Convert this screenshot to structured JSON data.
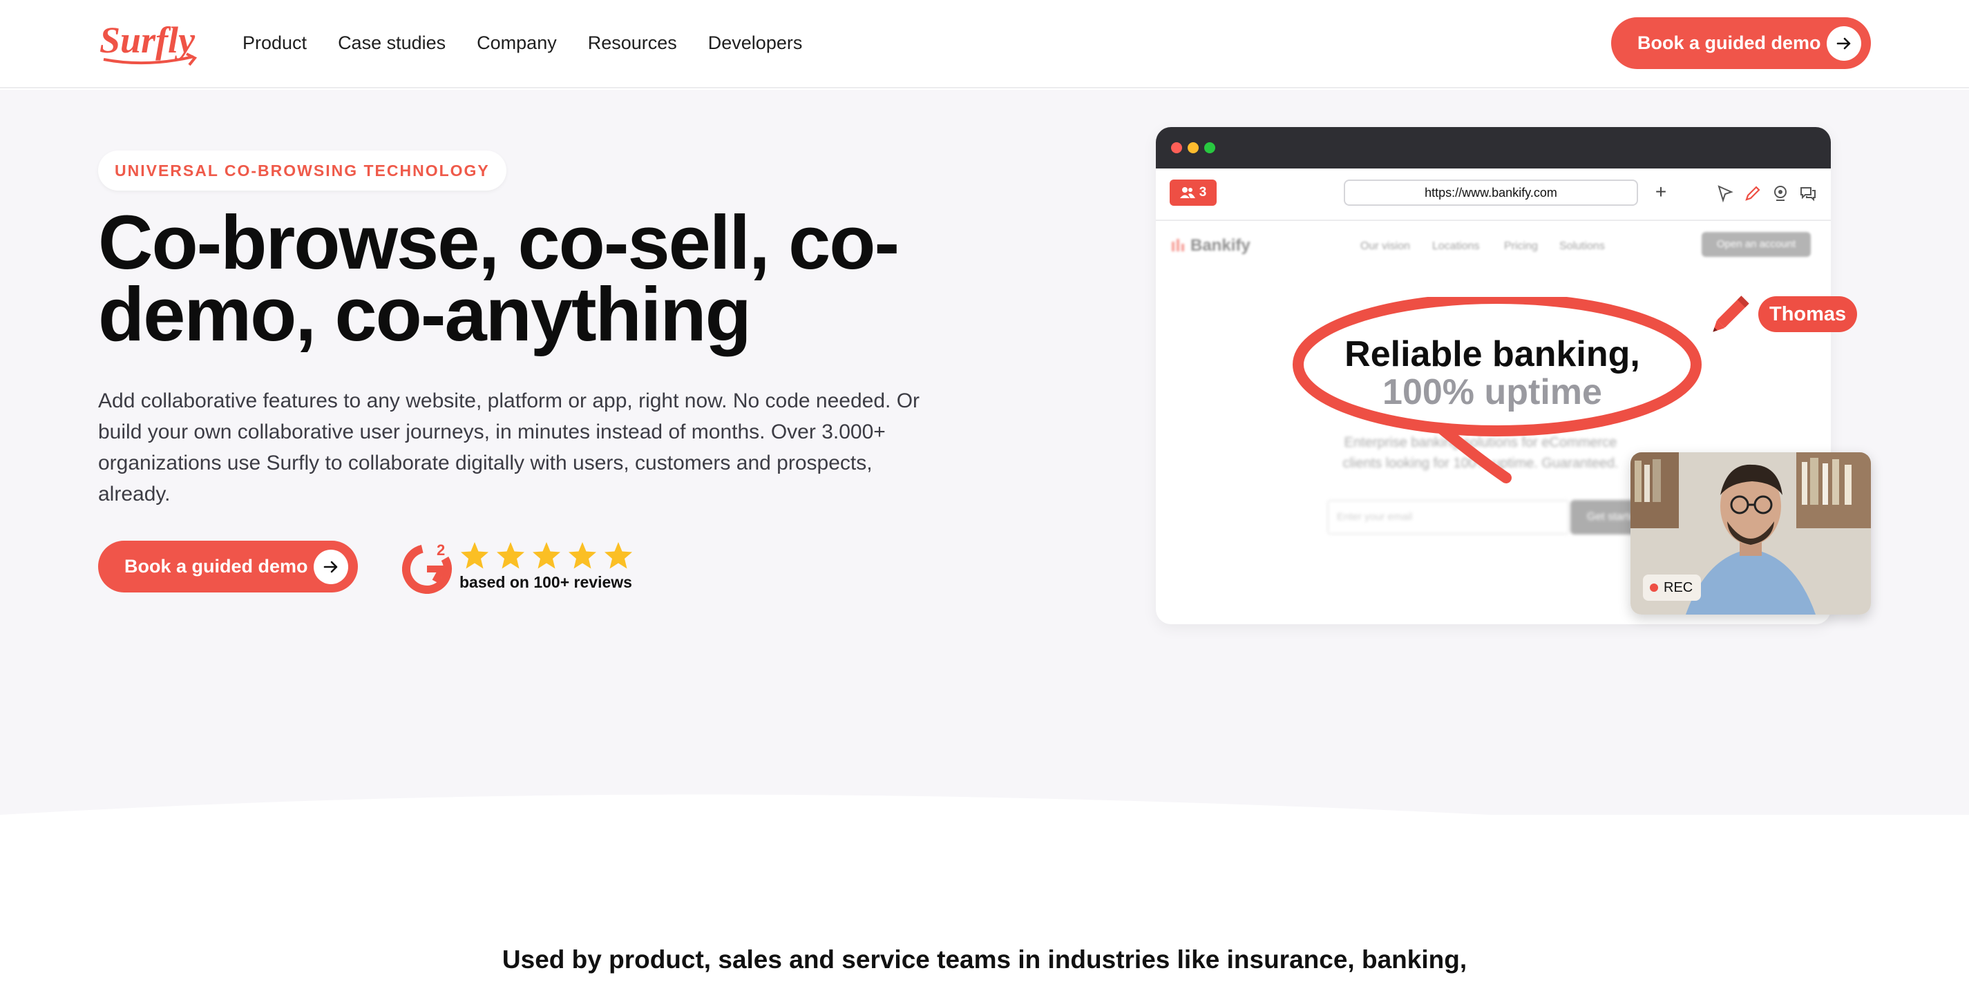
{
  "nav": {
    "logo_text": "Surfly",
    "links": [
      "Product",
      "Case studies",
      "Company",
      "Resources",
      "Developers"
    ],
    "cta_label": "Book a guided demo"
  },
  "hero": {
    "eyebrow": "UNIVERSAL CO-BROWSING TECHNOLOGY",
    "headline": "Co-browse, co-sell, co-demo, co-anything",
    "subtext": "Add collaborative features to any website, platform or app, right now. No code needed. Or build your own collaborative user journeys, in minutes instead of months. Over 3.000+ organizations use Surfly to collaborate digitally with users, customers and prospects, already.",
    "cta_label": "Book a guided demo",
    "rating_stars": 5,
    "reviews_text": "based on 100+ reviews"
  },
  "mockup": {
    "users_count": "3",
    "url": "https://www.bankify.com",
    "plus_label": "+",
    "site_name": "Bankify",
    "site_nav": [
      "Our vision",
      "Locations",
      "Pricing",
      "Solutions"
    ],
    "site_cta": "Open an account",
    "headline_line1": "Reliable banking,",
    "headline_line2": "100% uptime",
    "body_line1": "Enterprise banking solutions for eCommerce",
    "body_line2": "clients looking for 100% uptime. Guaranteed.",
    "email_placeholder": "Enter your email",
    "start_label": "Get started",
    "cursor_name": "Thomas",
    "rec_label": "REC"
  },
  "colors": {
    "brand": "#f0554a",
    "star": "#fbbf24",
    "hero_bg": "#f7f6f9"
  },
  "footer_teaser": {
    "text": "Used by product, sales and service teams in industries like insurance, banking,"
  }
}
